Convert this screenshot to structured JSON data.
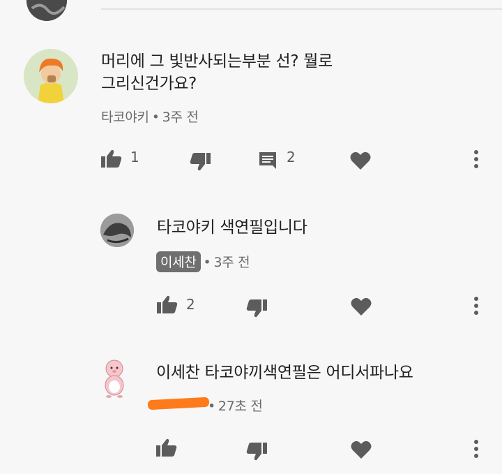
{
  "comments": [
    {
      "text_line1": "머리에 그 빛반사되는부분 선? 뭘로",
      "text_line2": "그리신건가요?",
      "author": "타코야키",
      "time": "3주 전",
      "likes": "1",
      "replies": "2"
    },
    {
      "text": "타코야키 색연필입니다",
      "author": "이세찬",
      "time": "3주 전",
      "likes": "2"
    },
    {
      "text": "이세찬 타코야끼색연필은 어디서파나요",
      "time": "27초 전"
    }
  ],
  "colors": {
    "background": "#f7f7f7",
    "icon": "#5c5c5c",
    "redaction": "#ff7a1a"
  }
}
